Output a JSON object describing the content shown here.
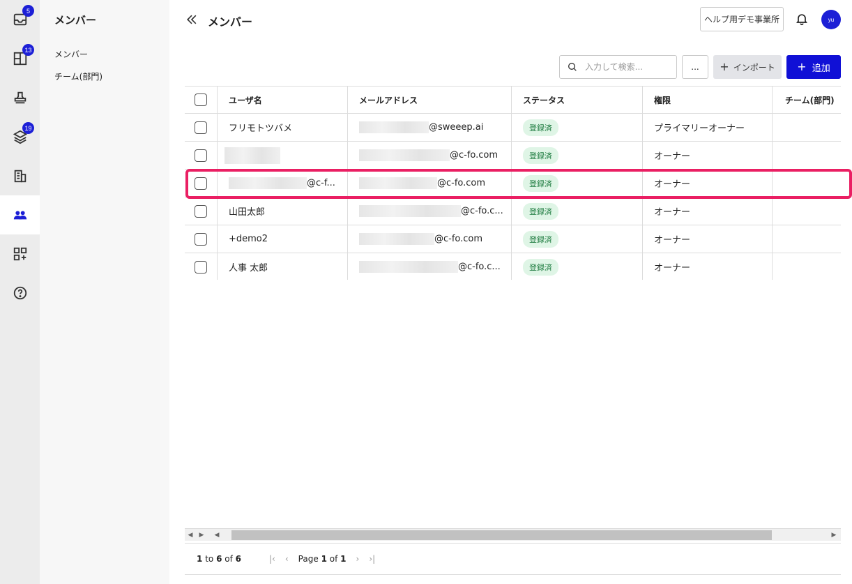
{
  "rail": {
    "items": [
      {
        "name": "inbox",
        "badge": "5"
      },
      {
        "name": "documents",
        "badge": "13"
      },
      {
        "name": "stamp",
        "badge": ""
      },
      {
        "name": "layers",
        "badge": "19"
      },
      {
        "name": "building",
        "badge": ""
      },
      {
        "name": "members",
        "badge": ""
      },
      {
        "name": "apps",
        "badge": ""
      },
      {
        "name": "help",
        "badge": ""
      }
    ]
  },
  "subnav": {
    "title": "メンバー",
    "items": [
      "メンバー",
      "チーム(部門)"
    ]
  },
  "header": {
    "title": "メンバー",
    "company": "ヘルプ用デモ事業所",
    "avatar": "yu"
  },
  "toolbar": {
    "search_placeholder": "入力して検索...",
    "more_label": "...",
    "import_label": "インポート",
    "add_label": "追加"
  },
  "table": {
    "columns": [
      "ユーザ名",
      "メールアドレス",
      "ステータス",
      "権限",
      "チーム(部門)"
    ],
    "rows": [
      {
        "name": "フリモトツバメ",
        "email_domain": "@sweeep.ai",
        "status": "登録済",
        "role": "プライマリーオーナー",
        "team": ""
      },
      {
        "name": "",
        "email_domain": "@c-fo.com",
        "status": "登録済",
        "role": "オーナー",
        "team": ""
      },
      {
        "name": "@c-f...",
        "email_domain": "@c-fo.com",
        "status": "登録済",
        "role": "オーナー",
        "team": ""
      },
      {
        "name": "山田太郎",
        "email_domain": "@c-fo.c...",
        "status": "登録済",
        "role": "オーナー",
        "team": ""
      },
      {
        "name": "+demo2",
        "email_domain": "@c-fo.com",
        "status": "登録済",
        "role": "オーナー",
        "team": ""
      },
      {
        "name": "人事 太郎",
        "email_domain": "@c-fo.c...",
        "status": "登録済",
        "role": "オーナー",
        "team": ""
      }
    ]
  },
  "pager": {
    "from": "1",
    "to_word": "to",
    "to": "6",
    "of_word": "of",
    "total": "6",
    "page_word": "Page",
    "page": "1",
    "of_word2": "of",
    "pages": "1"
  },
  "colors": {
    "accent": "#1010d6",
    "highlight": "#ea1f63",
    "status_bg": "#dff5e6"
  }
}
